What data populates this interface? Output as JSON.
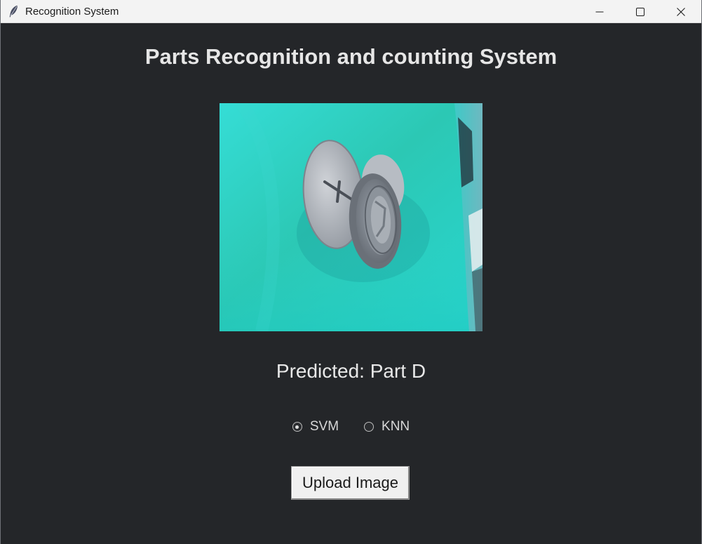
{
  "window": {
    "title": "Recognition System",
    "app_icon": "feather-icon",
    "controls": [
      "minimize-icon",
      "maximize-icon",
      "close-icon"
    ]
  },
  "main": {
    "heading": "Parts Recognition and counting System",
    "image": {
      "icon": "uploaded-part-photo",
      "subject": "gray plastic push-fit part on teal background"
    },
    "prediction_text": "Predicted: Part D",
    "model_options": [
      {
        "label": "SVM",
        "selected": true
      },
      {
        "label": "KNN",
        "selected": false
      }
    ],
    "upload_button_label": "Upload Image"
  },
  "colors": {
    "background": "#242629",
    "text": "#e6e6e6",
    "titlebar": "#f3f3f3",
    "photo_teal": "#2dd4c8"
  }
}
